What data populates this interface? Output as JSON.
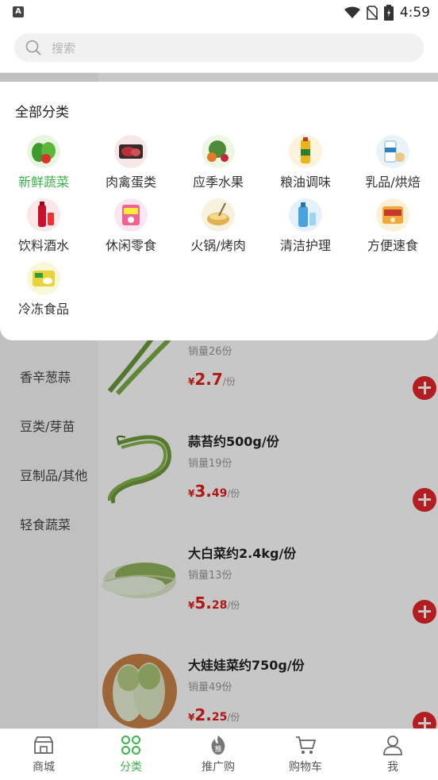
{
  "status_bar": {
    "time": "4:59",
    "app_badge": "A"
  },
  "search": {
    "placeholder": "搜索"
  },
  "category_panel": {
    "title": "全部分类",
    "items": [
      {
        "label": "新鲜蔬菜",
        "active": true
      },
      {
        "label": "肉禽蛋类"
      },
      {
        "label": "应季水果"
      },
      {
        "label": "粮油调味"
      },
      {
        "label": "乳品/烘焙"
      },
      {
        "label": "饮料酒水"
      },
      {
        "label": "休闲零食"
      },
      {
        "label": "火锅/烤肉"
      },
      {
        "label": "清洁护理"
      },
      {
        "label": "方便速食"
      },
      {
        "label": "冷冻食品"
      }
    ]
  },
  "side_menu": {
    "items": [
      {
        "label": "香辛葱蒜"
      },
      {
        "label": "豆类/芽苗"
      },
      {
        "label": "豆制品/其他"
      },
      {
        "label": "轻食蔬菜"
      }
    ]
  },
  "products": [
    {
      "name": "",
      "sales": "销量26份",
      "currency": "¥",
      "price_int": "2.7",
      "price_dec": "",
      "unit": "/份"
    },
    {
      "name": "蒜苔约500g/份",
      "sales": "销量19份",
      "currency": "¥",
      "price_int": "3.",
      "price_dec": "49",
      "unit": "/份"
    },
    {
      "name": "大白菜约2.4kg/份",
      "sales": "销量13份",
      "currency": "¥",
      "price_int": "5.",
      "price_dec": "28",
      "unit": "/份"
    },
    {
      "name": "大娃娃菜约750g/份",
      "sales": "销量49份",
      "currency": "¥",
      "price_int": "2.",
      "price_dec": "25",
      "unit": "/份"
    }
  ],
  "tab_bar": {
    "items": [
      {
        "label": "商城",
        "icon": "store-icon"
      },
      {
        "label": "分类",
        "icon": "grid-icon",
        "active": true
      },
      {
        "label": "推广购",
        "icon": "promo-icon"
      },
      {
        "label": "购物车",
        "icon": "cart-icon"
      },
      {
        "label": "我",
        "icon": "user-icon"
      }
    ]
  },
  "colors": {
    "accent": "#3bb34a",
    "price": "#e0201c",
    "add_button": "#e3262a"
  }
}
